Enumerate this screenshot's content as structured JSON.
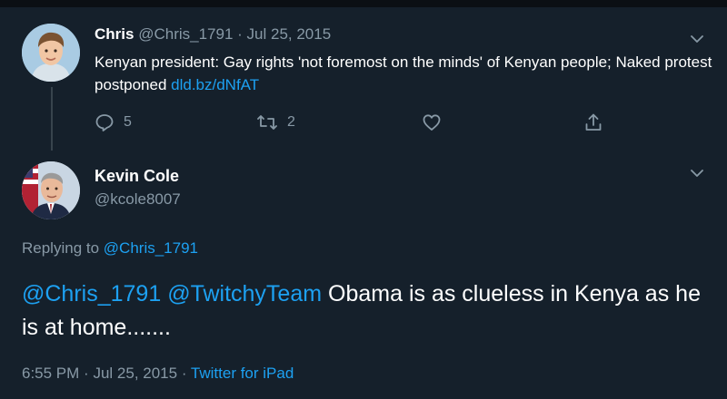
{
  "tweet1": {
    "author_name": "Chris",
    "handle": "@Chris_1791",
    "separator": "·",
    "date": "Jul 25, 2015",
    "text": "Kenyan president: Gay rights 'not foremost on the minds' of Kenyan people; Naked protest postponed",
    "link": "dld.bz/dNfAT",
    "replies_count": "5",
    "retweets_count": "2"
  },
  "tweet2": {
    "author_name": "Kevin Cole",
    "handle": "@kcole8007",
    "replying_prefix": "Replying to",
    "replying_to": "@Chris_1791",
    "mention1": "@Chris_1791",
    "mention2": "@TwitchyTeam",
    "text": "Obama is as clueless in Kenya as he is at home.......",
    "time": "6:55 PM",
    "separator": "·",
    "date": "Jul 25, 2015",
    "source": "Twitter for iPad"
  },
  "colors": {
    "background": "#15202b",
    "accent": "#1da1f2",
    "muted": "#8899a6"
  },
  "icons": [
    "chevron-down-icon",
    "reply-icon",
    "retweet-icon",
    "like-icon",
    "share-icon"
  ]
}
